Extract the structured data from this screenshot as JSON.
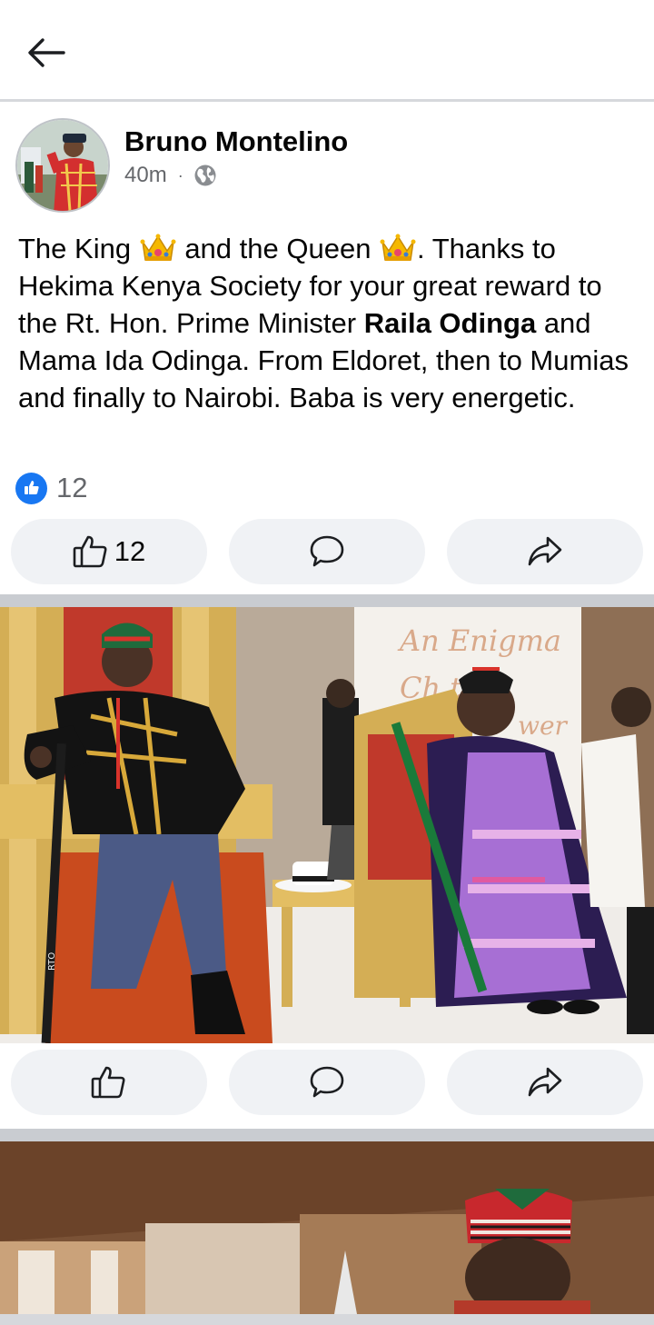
{
  "topbar": {
    "back_icon": "arrow-left-icon"
  },
  "post": {
    "author": "Bruno Montelino",
    "time": "40m",
    "separator": "·",
    "privacy_icon": "globe-icon",
    "text": {
      "p1": "The King ",
      "crown1_icon": "crown-emoji-icon",
      "p2": " and the Queen ",
      "crown2_icon": "crown-emoji-icon",
      "p3": ". Thanks to Hekima Kenya Society for your great reward to the Rt. Hon. Prime Minister ",
      "bold": "Raila Odinga",
      "p4": " and Mama Ida Odinga. From Eldoret, then to Mumias and finally to Nairobi. Baba is very energetic."
    },
    "reaction_count": "12",
    "reaction_icon": "like-badge-icon",
    "actions": {
      "like_count": "12",
      "like_icon": "thumbs-up-icon",
      "comment_icon": "comment-icon",
      "share_icon": "share-icon"
    }
  },
  "photo1": {
    "sign_line1": "An Enigma",
    "sign_line2": "Ch  ter,",
    "sign_line3": "wer",
    "cane_text": "RTO"
  },
  "photo1_actions": {
    "like_icon": "thumbs-up-icon",
    "comment_icon": "comment-icon",
    "share_icon": "share-icon"
  },
  "colors": {
    "accent": "#1877f2",
    "button_bg": "#f0f2f5",
    "separator": "#c9ccd1",
    "meta_text": "#65676b"
  }
}
